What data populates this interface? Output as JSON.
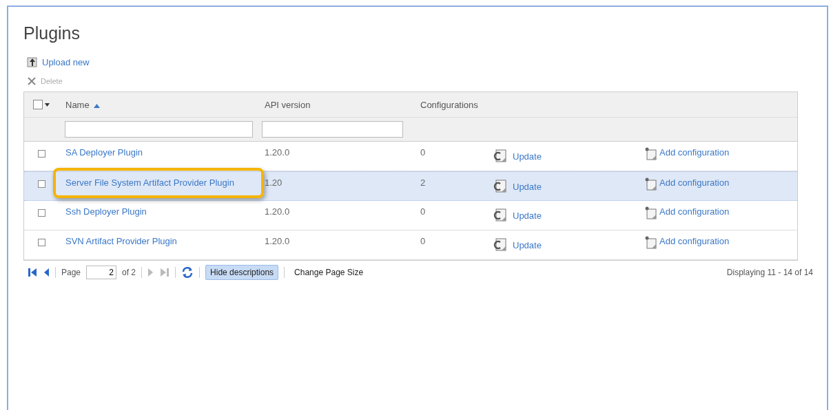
{
  "title": "Plugins",
  "actions": [
    {
      "kind": "upload",
      "label": "Upload new",
      "disabled": false
    },
    {
      "kind": "delete",
      "label": "Delete",
      "disabled": true
    }
  ],
  "table": {
    "columns": [
      "Name",
      "API version",
      "Configurations"
    ],
    "sort_ascending": true,
    "header_checkbox": {
      "checked": false
    },
    "rows": [
      {
        "name": "SA Deployer Plugin",
        "api": "1.20.0",
        "configurations": "0",
        "update": "Update",
        "add": "Add configuration",
        "checked": false,
        "selected": false,
        "highlighted": false
      },
      {
        "name": "Server File System Artifact Provider Plugin",
        "api": "1.20",
        "configurations": "2",
        "update": "Update",
        "add": "Add configuration",
        "checked": false,
        "selected": true,
        "highlighted": true
      },
      {
        "name": "Ssh Deployer Plugin",
        "api": "1.20.0",
        "configurations": "0",
        "update": "Update",
        "add": "Add configuration",
        "checked": false,
        "selected": false,
        "highlighted": false
      },
      {
        "name": "SVN Artifact Provider Plugin",
        "api": "1.20.0",
        "configurations": "0",
        "update": "Update",
        "add": "Add configuration",
        "checked": false,
        "selected": false,
        "highlighted": false
      }
    ]
  },
  "pager": {
    "page_label": "Page",
    "page": "2",
    "of": "of 2",
    "hide_descriptions": "Hide descriptions",
    "change_page_size": "Change Page Size",
    "displaying": "Displaying 11 - 14 of 14"
  }
}
